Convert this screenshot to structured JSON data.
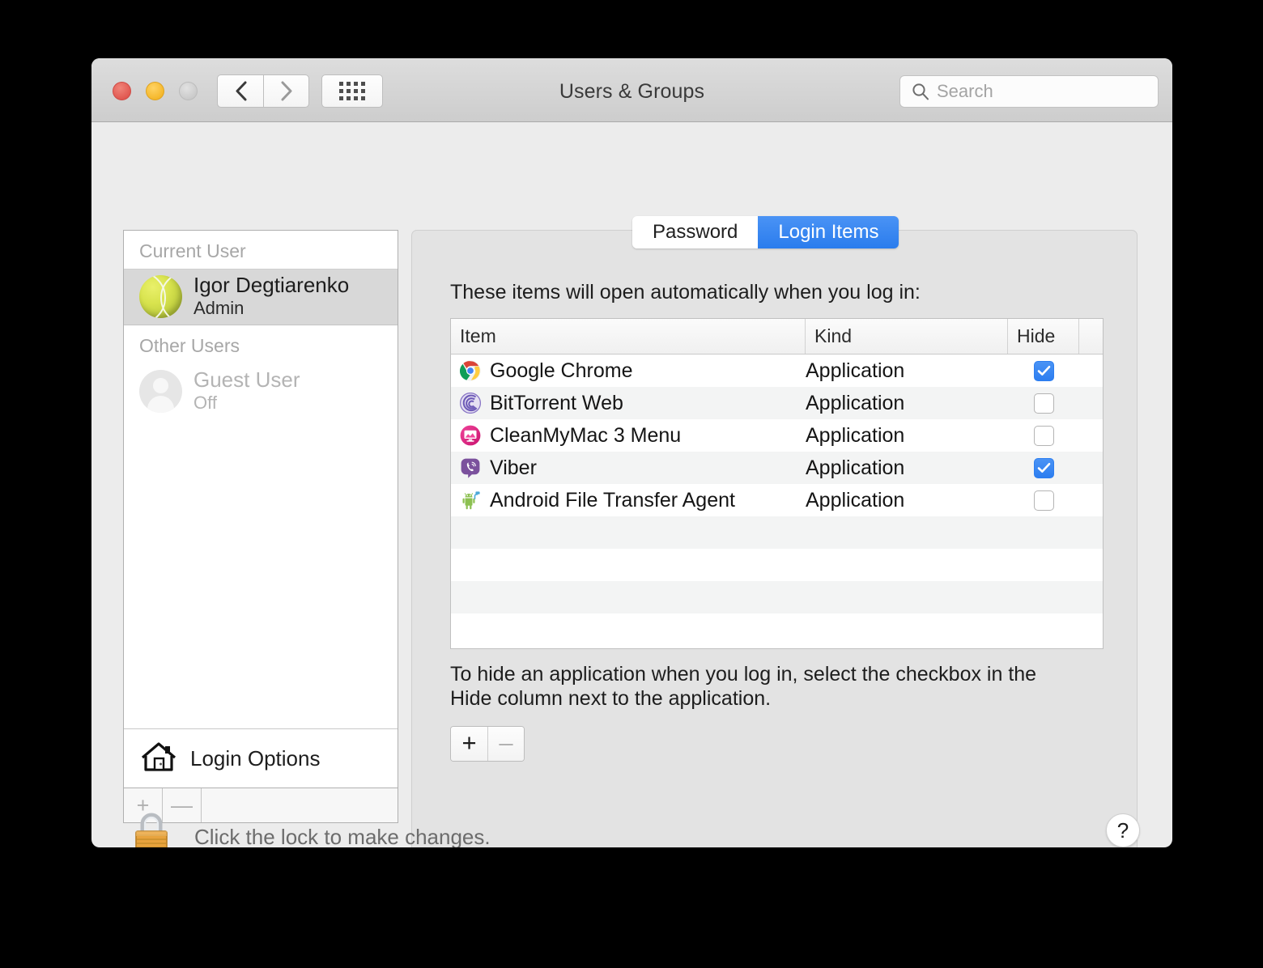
{
  "window": {
    "title": "Users & Groups",
    "traffic_lights": [
      "close",
      "minimize",
      "zoom"
    ],
    "nav": {
      "back": "back-chevron",
      "forward": "forward-chevron",
      "grid": "show-all-grid"
    },
    "search": {
      "placeholder": "Search",
      "value": "",
      "icon": "search-icon"
    }
  },
  "sidebar": {
    "groups": [
      {
        "label": "Current User",
        "users": [
          {
            "name": "Igor Degtiarenko",
            "role": "Admin",
            "selected": true,
            "avatar": "tennis-ball-avatar",
            "disabled": false
          }
        ]
      },
      {
        "label": "Other Users",
        "users": [
          {
            "name": "Guest User",
            "role": "Off",
            "selected": false,
            "avatar": "guest-person-avatar",
            "disabled": true
          }
        ]
      }
    ],
    "login_options": {
      "label": "Login Options",
      "icon": "home-icon"
    },
    "footer": {
      "add": "+",
      "remove": "—"
    }
  },
  "tabs": [
    {
      "label": "Password",
      "active": false
    },
    {
      "label": "Login Items",
      "active": true
    }
  ],
  "main": {
    "intro": "These items will open automatically when you log in:",
    "table": {
      "columns": [
        "Item",
        "Kind",
        "Hide"
      ],
      "rows": [
        {
          "item": "Google Chrome",
          "kind": "Application",
          "hide": true,
          "icon": "chrome-icon"
        },
        {
          "item": "BitTorrent Web",
          "kind": "Application",
          "hide": false,
          "icon": "bittorrent-icon"
        },
        {
          "item": "CleanMyMac 3 Menu",
          "kind": "Application",
          "hide": false,
          "icon": "cleanmymac-icon"
        },
        {
          "item": "Viber",
          "kind": "Application",
          "hide": true,
          "icon": "viber-icon"
        },
        {
          "item": "Android File Transfer Agent",
          "kind": "Application",
          "hide": false,
          "icon": "android-icon"
        }
      ],
      "empty_rows": 4
    },
    "help_text": "To hide an application when you log in, select the checkbox in the Hide column next to the application.",
    "add_remove": {
      "add": "+",
      "remove": "–"
    }
  },
  "footer": {
    "lock_label": "Click the lock to make changes.",
    "lock_icon": "closed-padlock-icon",
    "help_label": "?"
  },
  "colors": {
    "accent_blue": "#2d7ef0",
    "window_bg": "#ececec",
    "pane_bg": "#e3e3e3",
    "selected_row": "#d8d8d8",
    "desktop": "#000000"
  }
}
